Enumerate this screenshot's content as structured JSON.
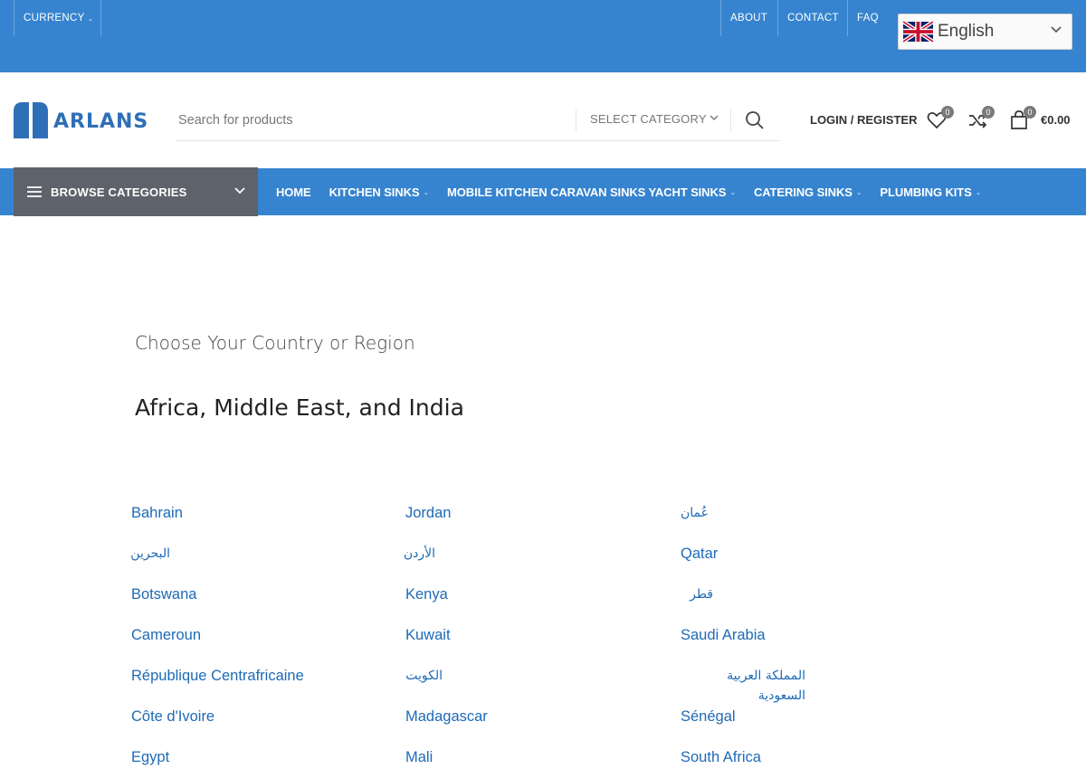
{
  "topbar": {
    "currency": "CURRENCY",
    "links": [
      "ABOUT",
      "CONTACT",
      "FAQ"
    ],
    "language": "English"
  },
  "header": {
    "logo_text": "ARLANS",
    "search_placeholder": "Search for products",
    "category_select": "SELECT CATEGORY",
    "login": "LOGIN / REGISTER",
    "wishlist_count": "0",
    "compare_count": "0",
    "cart_count": "0",
    "cart_total": "€0.00"
  },
  "nav": {
    "browse": "BROWSE CATEGORIES",
    "items": [
      "HOME",
      "KITCHEN SINKS",
      "MOBILE KITCHEN CARAVAN SINKS YACHT SINKS",
      "CATERING SINKS",
      "PLUMBING KITS"
    ]
  },
  "content": {
    "heading": "Choose Your Country or Region",
    "region": "Africa, Middle East, and India",
    "columns": [
      [
        "Bahrain",
        "البحرين",
        "Botswana",
        "Cameroun",
        "République Centrafricaine",
        "Côte d'Ivoire",
        "Egypt"
      ],
      [
        "Jordan",
        "الأردن",
        "Kenya",
        "Kuwait",
        "الكويت",
        "Madagascar",
        "Mali"
      ],
      [
        "عُمان",
        "Qatar",
        "قطر",
        "Saudi Arabia",
        "المملكة العربية السعودية",
        "Sénégal",
        "South Africa"
      ]
    ]
  },
  "colors": {
    "topbar": "#3684cf",
    "browse": "#5e636b",
    "link": "#1d6ab7"
  }
}
